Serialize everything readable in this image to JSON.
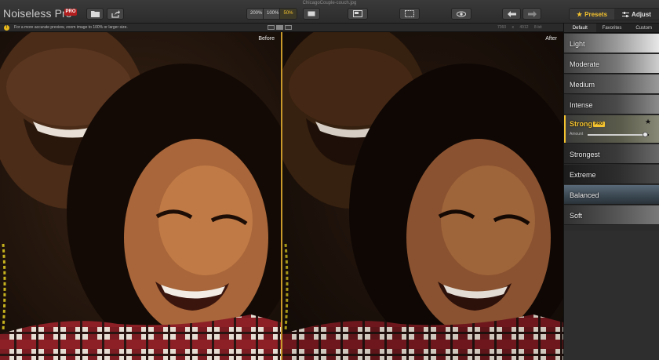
{
  "window": {
    "title": "ChicagoCouple-couch.jpg",
    "app_name": "Noiseless Pro",
    "pro_badge": "PRO"
  },
  "toolbar": {
    "zoom_options": [
      {
        "label": "200%",
        "active": false
      },
      {
        "label": "100%",
        "active": false
      },
      {
        "label": "50%",
        "active": true
      }
    ],
    "icons": [
      "open-folder-icon",
      "share-icon",
      "fit-screen-icon",
      "split-view-icon",
      "fullscreen-icon",
      "preview-eye-icon",
      "undo-icon",
      "redo-icon"
    ]
  },
  "panel_switch": {
    "presets_label": "Presets",
    "adjust_label": "Adjust",
    "active": "presets"
  },
  "infobar": {
    "message": "For a more accurate preview, zoom image to 100% or larger size.",
    "dimensions": "7360 x 4912",
    "bit_depth": "8-bit"
  },
  "panes": {
    "before_label": "Before",
    "after_label": "After"
  },
  "preset_tabs": [
    {
      "label": "Default",
      "active": true
    },
    {
      "label": "Favorites",
      "active": false
    },
    {
      "label": "Custom",
      "active": false
    }
  ],
  "presets": [
    {
      "name": "Light",
      "selected": false
    },
    {
      "name": "Moderate",
      "selected": false
    },
    {
      "name": "Medium",
      "selected": false
    },
    {
      "name": "Intense",
      "selected": false
    },
    {
      "name": "Strong",
      "selected": true,
      "pro": "PRO",
      "amount_label": "Amount",
      "amount": 0.95
    },
    {
      "name": "Strongest",
      "selected": false
    },
    {
      "name": "Extreme",
      "selected": false
    },
    {
      "name": "Balanced",
      "selected": false
    },
    {
      "name": "Soft",
      "selected": false
    }
  ],
  "colors": {
    "accent": "#f3c22e",
    "pro_red": "#b21e1e",
    "panel_bg": "#2b2b2b",
    "divider": "#c99a2a"
  }
}
